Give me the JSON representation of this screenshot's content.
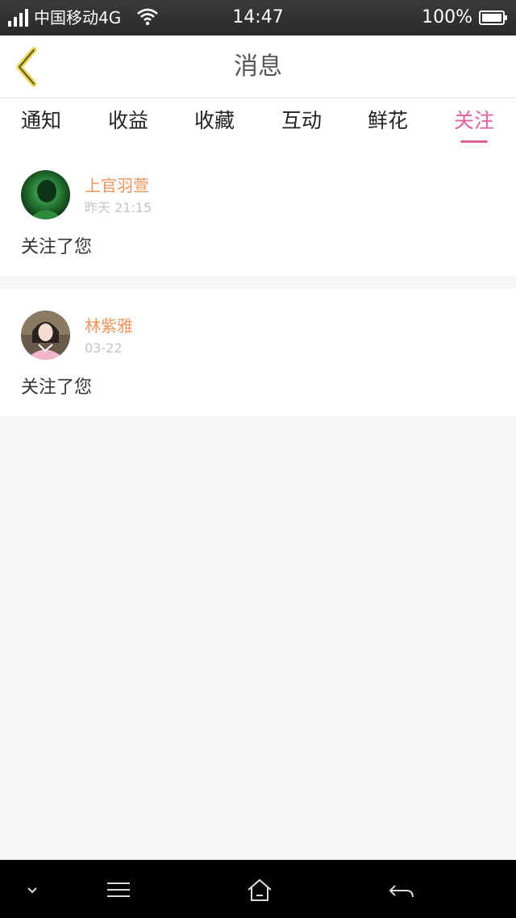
{
  "status_bar": {
    "carrier": "中国移动4G",
    "time": "14:47",
    "battery_percent": "100%",
    "icons": [
      "signal-icon",
      "wifi-icon",
      "battery-icon"
    ]
  },
  "header": {
    "title": "消息",
    "back_icon": "chevron-left-icon",
    "accent_color": "#e8d44d"
  },
  "tabs": [
    {
      "label": "通知",
      "active": false
    },
    {
      "label": "收益",
      "active": false
    },
    {
      "label": "收藏",
      "active": false
    },
    {
      "label": "互动",
      "active": false
    },
    {
      "label": "鲜花",
      "active": false
    },
    {
      "label": "关注",
      "active": true
    }
  ],
  "theme": {
    "active_tab_color": "#e15fa0",
    "username_color": "#f0945c"
  },
  "feed": [
    {
      "username": "上官羽萱",
      "time": "昨天 21:15",
      "message": "关注了您",
      "avatar_icon": "avatar-image"
    },
    {
      "username": "林紫雅",
      "time": "03-22",
      "message": "关注了您",
      "avatar_icon": "avatar-image"
    }
  ],
  "system_nav": {
    "icons": [
      "chevron-down-icon",
      "menu-icon",
      "home-icon",
      "back-arrow-icon"
    ]
  }
}
